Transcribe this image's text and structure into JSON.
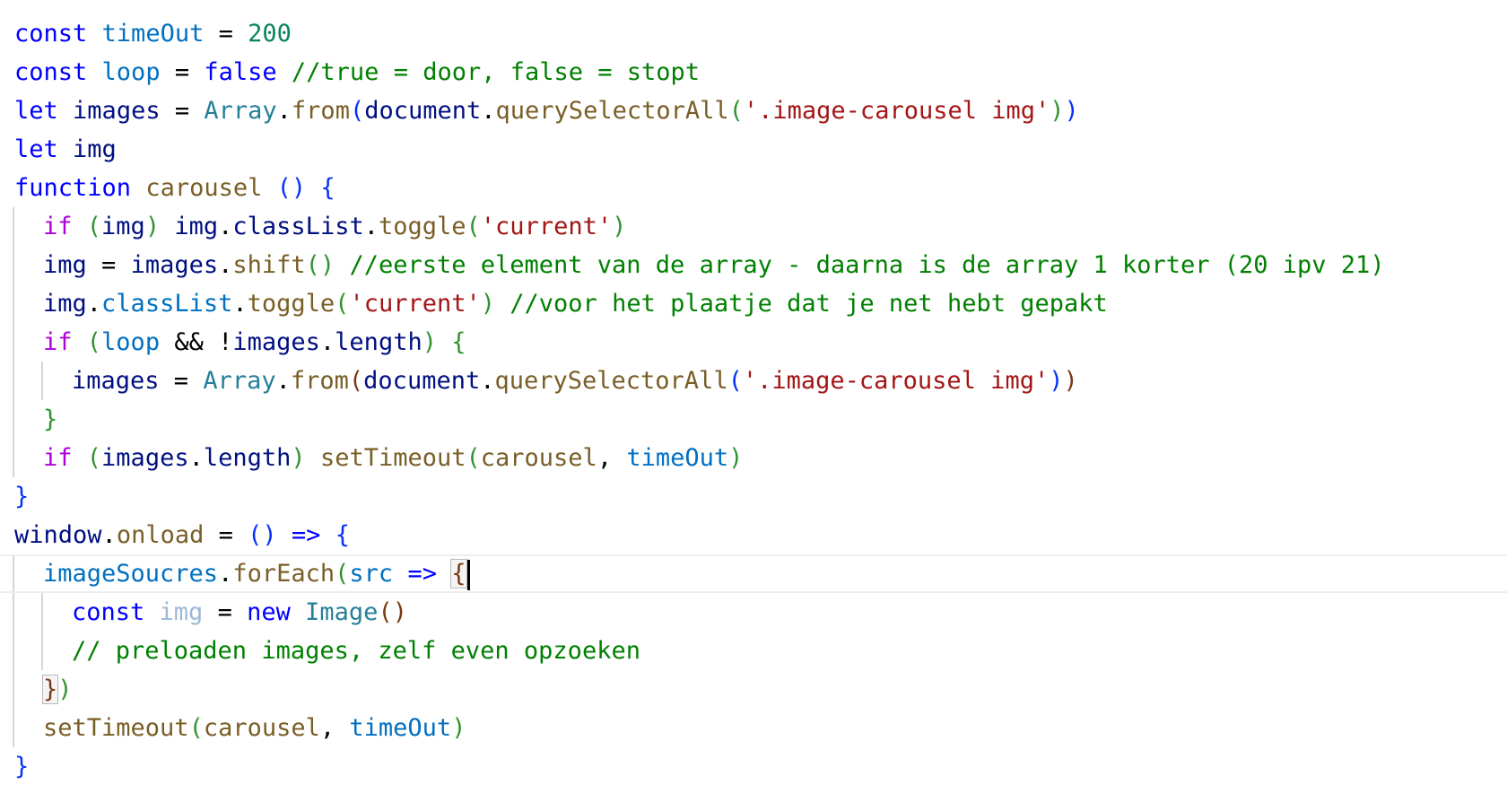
{
  "editor": {
    "language": "javascript",
    "lines": [
      {
        "indent": 0,
        "tokens": [
          {
            "t": "const",
            "c": "kw"
          },
          {
            "t": " "
          },
          {
            "t": "timeOut",
            "c": "blue"
          },
          {
            "t": " = "
          },
          {
            "t": "200",
            "c": "num"
          }
        ]
      },
      {
        "indent": 0,
        "tokens": [
          {
            "t": "const",
            "c": "kw"
          },
          {
            "t": " "
          },
          {
            "t": "loop",
            "c": "blue"
          },
          {
            "t": " = "
          },
          {
            "t": "false",
            "c": "kw"
          },
          {
            "t": " "
          },
          {
            "t": "//true = door, false = stopt",
            "c": "cmt"
          }
        ]
      },
      {
        "indent": 0,
        "tokens": [
          {
            "t": "let",
            "c": "kw"
          },
          {
            "t": " "
          },
          {
            "t": "images",
            "c": "var"
          },
          {
            "t": " = "
          },
          {
            "t": "Array",
            "c": "cls"
          },
          {
            "t": "."
          },
          {
            "t": "from",
            "c": "fn"
          },
          {
            "t": "(",
            "c": "p1"
          },
          {
            "t": "document",
            "c": "var"
          },
          {
            "t": "."
          },
          {
            "t": "querySelectorAll",
            "c": "fn"
          },
          {
            "t": "(",
            "c": "p2"
          },
          {
            "t": "'.image-carousel img'",
            "c": "str"
          },
          {
            "t": ")",
            "c": "p2"
          },
          {
            "t": ")",
            "c": "p1"
          }
        ]
      },
      {
        "indent": 0,
        "tokens": [
          {
            "t": "let",
            "c": "kw"
          },
          {
            "t": " "
          },
          {
            "t": "img",
            "c": "var"
          }
        ]
      },
      {
        "indent": 0,
        "tokens": [
          {
            "t": "function",
            "c": "kw"
          },
          {
            "t": " "
          },
          {
            "t": "carousel",
            "c": "fn"
          },
          {
            "t": " "
          },
          {
            "t": "()",
            "c": "p1"
          },
          {
            "t": " "
          },
          {
            "t": "{",
            "c": "p1"
          }
        ]
      },
      {
        "indent": 1,
        "tokens": [
          {
            "t": "if",
            "c": "ctl"
          },
          {
            "t": " "
          },
          {
            "t": "(",
            "c": "p2"
          },
          {
            "t": "img",
            "c": "var"
          },
          {
            "t": ")",
            "c": "p2"
          },
          {
            "t": " "
          },
          {
            "t": "img",
            "c": "var"
          },
          {
            "t": "."
          },
          {
            "t": "classList",
            "c": "var"
          },
          {
            "t": "."
          },
          {
            "t": "toggle",
            "c": "fn"
          },
          {
            "t": "(",
            "c": "p2"
          },
          {
            "t": "'current'",
            "c": "str"
          },
          {
            "t": ")",
            "c": "p2"
          }
        ]
      },
      {
        "indent": 1,
        "tokens": [
          {
            "t": "img",
            "c": "var"
          },
          {
            "t": " = "
          },
          {
            "t": "images",
            "c": "var"
          },
          {
            "t": "."
          },
          {
            "t": "shift",
            "c": "fn"
          },
          {
            "t": "()",
            "c": "p2"
          },
          {
            "t": " "
          },
          {
            "t": "//eerste element van de array - daarna is de array 1 korter (20 ipv 21)",
            "c": "cmt"
          }
        ]
      },
      {
        "indent": 1,
        "tokens": [
          {
            "t": "img",
            "c": "var"
          },
          {
            "t": "."
          },
          {
            "t": "classList",
            "c": "blue"
          },
          {
            "t": "."
          },
          {
            "t": "toggle",
            "c": "fn"
          },
          {
            "t": "(",
            "c": "p2"
          },
          {
            "t": "'current'",
            "c": "str"
          },
          {
            "t": ")",
            "c": "p2"
          },
          {
            "t": " "
          },
          {
            "t": "//voor het plaatje dat je net hebt gepakt",
            "c": "cmt"
          }
        ]
      },
      {
        "indent": 1,
        "tokens": [
          {
            "t": "if",
            "c": "ctl"
          },
          {
            "t": " "
          },
          {
            "t": "(",
            "c": "p2"
          },
          {
            "t": "loop",
            "c": "blue"
          },
          {
            "t": " && !"
          },
          {
            "t": "images",
            "c": "var"
          },
          {
            "t": "."
          },
          {
            "t": "length",
            "c": "var"
          },
          {
            "t": ")",
            "c": "p2"
          },
          {
            "t": " "
          },
          {
            "t": "{",
            "c": "p2"
          }
        ]
      },
      {
        "indent": 2,
        "tokens": [
          {
            "t": "images",
            "c": "var"
          },
          {
            "t": " = "
          },
          {
            "t": "Array",
            "c": "cls"
          },
          {
            "t": "."
          },
          {
            "t": "from",
            "c": "fn"
          },
          {
            "t": "(",
            "c": "p3"
          },
          {
            "t": "document",
            "c": "var"
          },
          {
            "t": "."
          },
          {
            "t": "querySelectorAll",
            "c": "fn"
          },
          {
            "t": "(",
            "c": "p1"
          },
          {
            "t": "'.image-carousel img'",
            "c": "str"
          },
          {
            "t": ")",
            "c": "p1"
          },
          {
            "t": ")",
            "c": "p3"
          }
        ]
      },
      {
        "indent": 1,
        "tokens": [
          {
            "t": "}",
            "c": "p2"
          }
        ]
      },
      {
        "indent": 1,
        "tokens": [
          {
            "t": "if",
            "c": "ctl"
          },
          {
            "t": " "
          },
          {
            "t": "(",
            "c": "p2"
          },
          {
            "t": "images",
            "c": "var"
          },
          {
            "t": "."
          },
          {
            "t": "length",
            "c": "var"
          },
          {
            "t": ")",
            "c": "p2"
          },
          {
            "t": " "
          },
          {
            "t": "setTimeout",
            "c": "fn"
          },
          {
            "t": "(",
            "c": "p2"
          },
          {
            "t": "carousel",
            "c": "fn"
          },
          {
            "t": ", "
          },
          {
            "t": "timeOut",
            "c": "blue"
          },
          {
            "t": ")",
            "c": "p2"
          }
        ]
      },
      {
        "indent": 0,
        "tokens": [
          {
            "t": "}",
            "c": "p1"
          }
        ]
      },
      {
        "indent": 0,
        "tokens": [
          {
            "t": "window",
            "c": "var"
          },
          {
            "t": "."
          },
          {
            "t": "onload",
            "c": "fn"
          },
          {
            "t": " = "
          },
          {
            "t": "()",
            "c": "p1"
          },
          {
            "t": " "
          },
          {
            "t": "=>",
            "c": "kw"
          },
          {
            "t": " "
          },
          {
            "t": "{",
            "c": "p1"
          }
        ]
      },
      {
        "indent": 1,
        "current": true,
        "tokens": [
          {
            "t": "imageSoucres",
            "c": "blue"
          },
          {
            "t": "."
          },
          {
            "t": "forEach",
            "c": "fn"
          },
          {
            "t": "(",
            "c": "p2"
          },
          {
            "t": "src",
            "c": "blue"
          },
          {
            "t": " "
          },
          {
            "t": "=>",
            "c": "kw"
          },
          {
            "t": " "
          },
          {
            "t": "{",
            "c": "p3",
            "m": true
          },
          {
            "cursor": true
          }
        ]
      },
      {
        "indent": 2,
        "tokens": [
          {
            "t": "const",
            "c": "kw"
          },
          {
            "t": " "
          },
          {
            "t": "img",
            "c": "dim"
          },
          {
            "t": " = "
          },
          {
            "t": "new",
            "c": "kw"
          },
          {
            "t": " "
          },
          {
            "t": "Image",
            "c": "cls"
          },
          {
            "t": "()",
            "c": "p3"
          }
        ]
      },
      {
        "indent": 2,
        "tokens": [
          {
            "t": "// preloaden images, zelf even opzoeken",
            "c": "cmt"
          }
        ]
      },
      {
        "indent": 1,
        "tokens": [
          {
            "t": "}",
            "c": "p3",
            "m": true
          },
          {
            "t": ")",
            "c": "p2"
          }
        ]
      },
      {
        "indent": 1,
        "tokens": [
          {
            "t": "setTimeout",
            "c": "fn"
          },
          {
            "t": "(",
            "c": "p2"
          },
          {
            "t": "carousel",
            "c": "fn"
          },
          {
            "t": ", "
          },
          {
            "t": "timeOut",
            "c": "blue"
          },
          {
            "t": ")",
            "c": "p2"
          }
        ]
      },
      {
        "indent": 0,
        "tokens": [
          {
            "t": "}",
            "c": "p1"
          }
        ]
      }
    ]
  }
}
